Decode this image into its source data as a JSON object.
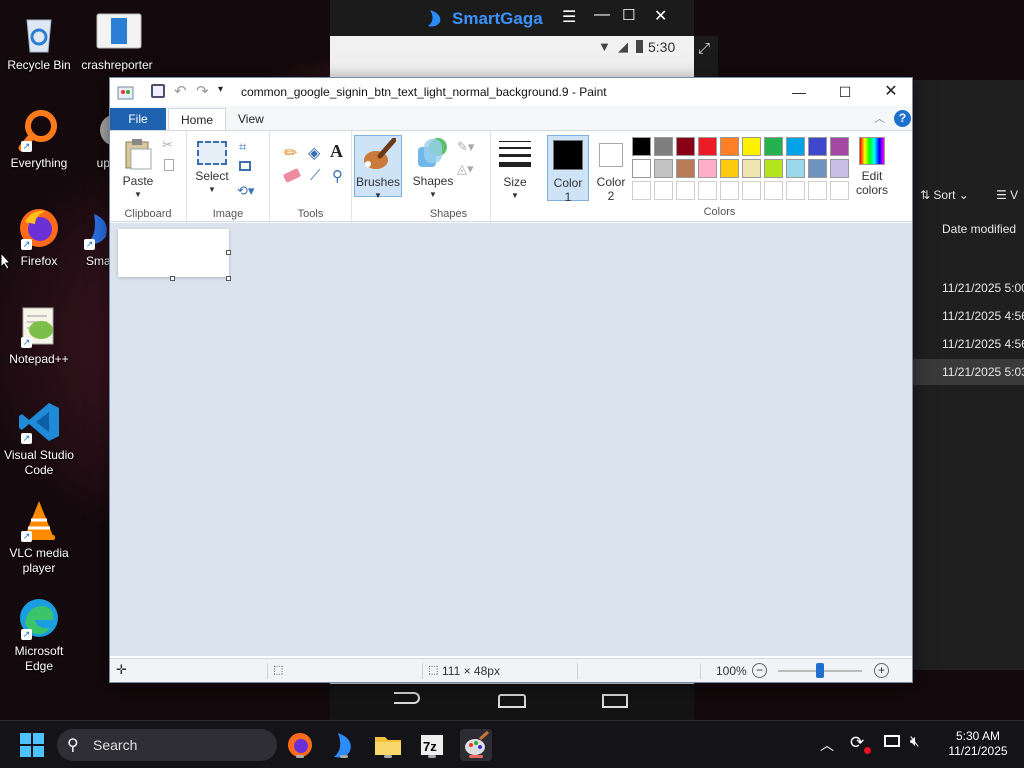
{
  "desktop": {
    "icons": [
      {
        "label": "Recycle Bin"
      },
      {
        "label": "crashreporter"
      },
      {
        "label": "Everything"
      },
      {
        "label": "up"
      },
      {
        "label": "Firefox"
      },
      {
        "label": "Sma"
      },
      {
        "label": "Notepad++"
      },
      {
        "label": "Visual Studio Code"
      },
      {
        "label": "VLC media player"
      },
      {
        "label": "Microsoft Edge"
      }
    ]
  },
  "smartgaga": {
    "title": "SmartGaga",
    "time": "5:30"
  },
  "explorer": {
    "sort_label": "Sort",
    "view_label": "V",
    "column_header": "Date modified",
    "rows": [
      "11/21/2025 5:00",
      "11/21/2025 4:56",
      "11/21/2025 4:56",
      "11/21/2025 5:03"
    ]
  },
  "paint": {
    "title": "common_google_signin_btn_text_light_normal_background.9 - Paint",
    "tabs": {
      "file": "File",
      "home": "Home",
      "view": "View"
    },
    "groups": {
      "clipboard": "Clipboard",
      "image": "Image",
      "tools": "Tools",
      "shapes": "Shapes",
      "colors": "Colors"
    },
    "buttons": {
      "paste": "Paste",
      "select": "Select",
      "brushes": "Brushes",
      "shapes": "Shapes",
      "size": "Size",
      "color1": "Color 1",
      "color2": "Color 2",
      "edit_colors": "Edit colors"
    },
    "palette_row1": [
      "#000000",
      "#7f7f7f",
      "#880015",
      "#ed1c24",
      "#ff7f27",
      "#fff200",
      "#22b14c",
      "#00a2e8",
      "#3f48cc",
      "#a349a4"
    ],
    "palette_row2": [
      "#ffffff",
      "#c3c3c3",
      "#b97a57",
      "#ffaec9",
      "#ffc90e",
      "#efe4b0",
      "#b5e61d",
      "#99d9ea",
      "#7092be",
      "#c8bfe7"
    ],
    "color1": "#000000",
    "color2": "#ffffff",
    "status": {
      "size": "111 × 48px",
      "zoom": "100%"
    }
  },
  "taskbar": {
    "search_placeholder": "Search",
    "time": "5:30 AM",
    "date": "11/21/2025"
  }
}
